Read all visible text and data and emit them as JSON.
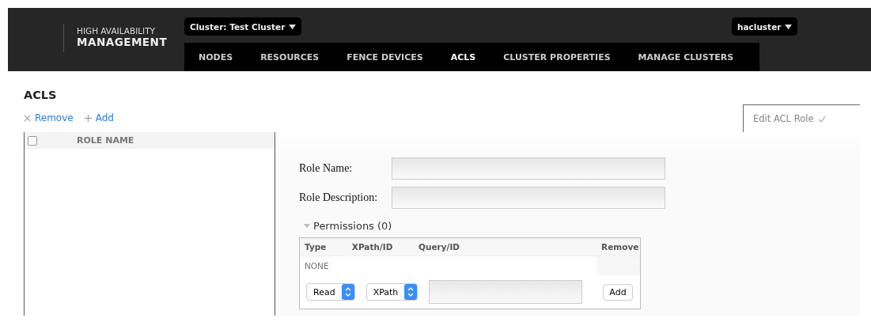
{
  "header": {
    "logo": {
      "line_1": "HIGH AVAILABILITY",
      "line_2": "MANAGEMENT"
    },
    "cluster_selector": "Cluster: Test Cluster",
    "user_menu": "hacluster"
  },
  "nav_tabs": [
    {
      "label": "NODES",
      "selected": false
    },
    {
      "label": "RESOURCES",
      "selected": false
    },
    {
      "label": "FENCE DEVICES",
      "selected": false
    },
    {
      "label": "ACLS",
      "selected": true
    },
    {
      "label": "CLUSTER PROPERTIES",
      "selected": false
    },
    {
      "label": "MANAGE CLUSTERS",
      "selected": false
    }
  ],
  "page_title": "ACLS",
  "toolbar": [
    {
      "kind": "remove",
      "label": "Remove"
    },
    {
      "kind": "add",
      "label": "Add"
    }
  ],
  "role_list": {
    "select_all_checked": false,
    "column": "ROLE NAME"
  },
  "edit_tab": {
    "label": "Edit ACL Role"
  },
  "form": {
    "fields": [
      {
        "label": "Role Name:"
      },
      {
        "label": "Role Description:"
      }
    ],
    "permissions": {
      "title": "Permissions (0)",
      "expanded": true,
      "columns": [
        "Type",
        "XPath/ID",
        "Query/ID",
        "Remove"
      ],
      "empty_text": "NONE",
      "new_row": {
        "type": "Read",
        "match": "XPath",
        "add_button": "Add"
      }
    }
  }
}
